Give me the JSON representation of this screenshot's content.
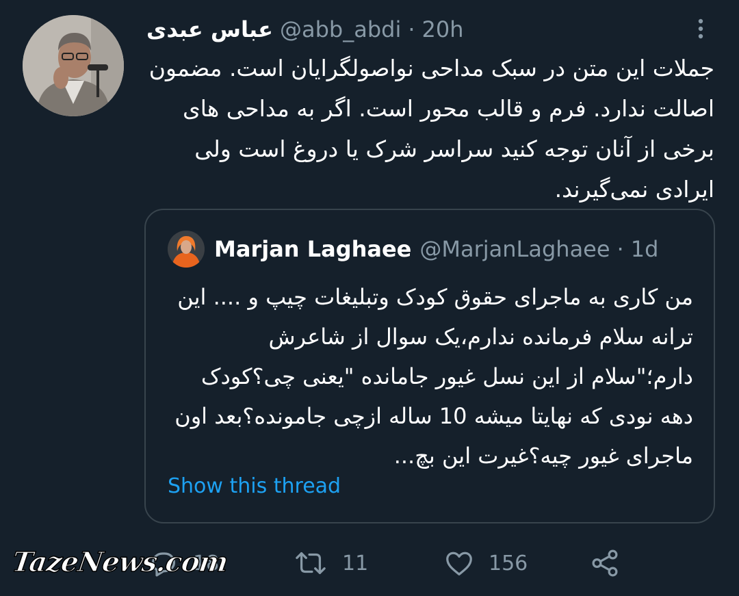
{
  "tweet": {
    "author_name": "عباس عبدی",
    "handle": "@abb_abdi",
    "separator": "·",
    "time": "20h",
    "text": "جملات این متن در سبک مداحی نواصولگرایان است. مضمون اصالت ندارد. فرم و قالب محور است. اگر به مداحی های برخی از آنان توجه کنید سراسر شرک یا دروغ است ولی ایرادی نمی‌گیرند.",
    "more_icon": "more-vertical-icon"
  },
  "quoted": {
    "author_name": "Marjan Laghaee",
    "handle": "@MarjanLaghaee",
    "separator": "·",
    "time": "1d",
    "text": "من کاری به ماجرای حقوق کودک وتبلیغات چیپ و .... این ترانه سلام فرمانده ندارم،یک سوال از شاعرش دارم؛\"سلام از این نسل غیور جامانده \"یعنی چی؟کودک دهه نودی که نهایتا میشه 10 ساله ازچی جامونده؟بعد اون ماجرای غیور چیه؟غیرت این بچ...",
    "show_thread": "Show this thread"
  },
  "actions": {
    "reply_count": "18",
    "retweet_count": "11",
    "like_count": "156",
    "icons": [
      "reply-icon",
      "retweet-icon",
      "like-icon",
      "share-icon"
    ]
  },
  "watermark": "TazeNews.com",
  "colors": {
    "background": "#15202b",
    "text": "#ffffff",
    "muted": "#8899a6",
    "link": "#1da1f2",
    "border": "#38444d"
  }
}
